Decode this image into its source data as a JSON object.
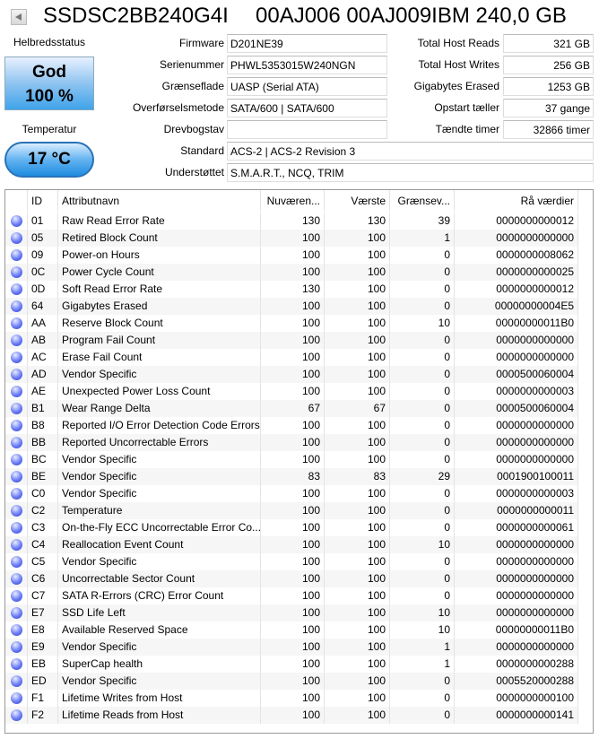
{
  "header": {
    "model": "SSDSC2BB240G4I",
    "title": "00AJ006 00AJ009IBM 240,0 GB"
  },
  "health": {
    "label": "Helbredsstatus",
    "status": "God",
    "percent": "100 %",
    "color": "#3fa3ea"
  },
  "temperature": {
    "label": "Temperatur",
    "value": "17 °C"
  },
  "info": [
    {
      "label": "Firmware",
      "value": "D201NE39"
    },
    {
      "label": "Serienummer",
      "value": "PHWL5353015W240NGN"
    },
    {
      "label": "Grænseflade",
      "value": "UASP (Serial ATA)"
    },
    {
      "label": "Overførselsmetode",
      "value": "SATA/600 | SATA/600"
    },
    {
      "label": "Drevbogstav",
      "value": ""
    },
    {
      "label": "Standard",
      "value": "ACS-2 | ACS-2 Revision 3"
    },
    {
      "label": "Understøttet",
      "value": "S.M.A.R.T., NCQ, TRIM"
    }
  ],
  "stats": [
    {
      "label": "Total Host Reads",
      "value": "321 GB"
    },
    {
      "label": "Total Host Writes",
      "value": "256 GB"
    },
    {
      "label": "Gigabytes Erased",
      "value": "1253 GB"
    },
    {
      "label": "Opstart tæller",
      "value": "37 gange"
    },
    {
      "label": "Tændte timer",
      "value": "32866 timer"
    }
  ],
  "table": {
    "columns": [
      "",
      "ID",
      "Attributnavn",
      "Nuværen...",
      "Værste",
      "Grænsev...",
      "Rå værdier"
    ],
    "rows": [
      [
        "01",
        "Raw Read Error Rate",
        "130",
        "130",
        "39",
        "0000000000012"
      ],
      [
        "05",
        "Retired Block Count",
        "100",
        "100",
        "1",
        "0000000000000"
      ],
      [
        "09",
        "Power-on Hours",
        "100",
        "100",
        "0",
        "0000000008062"
      ],
      [
        "0C",
        "Power Cycle Count",
        "100",
        "100",
        "0",
        "0000000000025"
      ],
      [
        "0D",
        "Soft Read Error Rate",
        "130",
        "100",
        "0",
        "0000000000012"
      ],
      [
        "64",
        "Gigabytes Erased",
        "100",
        "100",
        "0",
        "00000000004E5"
      ],
      [
        "AA",
        "Reserve Block Count",
        "100",
        "100",
        "10",
        "00000000011B0"
      ],
      [
        "AB",
        "Program Fail Count",
        "100",
        "100",
        "0",
        "0000000000000"
      ],
      [
        "AC",
        "Erase Fail Count",
        "100",
        "100",
        "0",
        "0000000000000"
      ],
      [
        "AD",
        "Vendor Specific",
        "100",
        "100",
        "0",
        "0000500060004"
      ],
      [
        "AE",
        "Unexpected Power Loss Count",
        "100",
        "100",
        "0",
        "0000000000003"
      ],
      [
        "B1",
        "Wear Range Delta",
        "67",
        "67",
        "0",
        "0000500060004"
      ],
      [
        "B8",
        "Reported I/O Error Detection Code Errors",
        "100",
        "100",
        "0",
        "0000000000000"
      ],
      [
        "BB",
        "Reported Uncorrectable Errors",
        "100",
        "100",
        "0",
        "0000000000000"
      ],
      [
        "BC",
        "Vendor Specific",
        "100",
        "100",
        "0",
        "0000000000000"
      ],
      [
        "BE",
        "Vendor Specific",
        "83",
        "83",
        "29",
        "0001900100011"
      ],
      [
        "C0",
        "Vendor Specific",
        "100",
        "100",
        "0",
        "0000000000003"
      ],
      [
        "C2",
        "Temperature",
        "100",
        "100",
        "0",
        "0000000000011"
      ],
      [
        "C3",
        "On-the-Fly ECC Uncorrectable Error Co...",
        "100",
        "100",
        "0",
        "0000000000061"
      ],
      [
        "C4",
        "Reallocation Event Count",
        "100",
        "100",
        "10",
        "0000000000000"
      ],
      [
        "C5",
        "Vendor Specific",
        "100",
        "100",
        "0",
        "0000000000000"
      ],
      [
        "C6",
        "Uncorrectable Sector Count",
        "100",
        "100",
        "0",
        "0000000000000"
      ],
      [
        "C7",
        "SATA R-Errors (CRC) Error Count",
        "100",
        "100",
        "0",
        "0000000000000"
      ],
      [
        "E7",
        "SSD Life Left",
        "100",
        "100",
        "10",
        "0000000000000"
      ],
      [
        "E8",
        "Available Reserved Space",
        "100",
        "100",
        "10",
        "00000000011B0"
      ],
      [
        "E9",
        "Vendor Specific",
        "100",
        "100",
        "1",
        "0000000000000"
      ],
      [
        "EB",
        "SuperCap health",
        "100",
        "100",
        "1",
        "0000000000288"
      ],
      [
        "ED",
        "Vendor Specific",
        "100",
        "100",
        "0",
        "0005520000288"
      ],
      [
        "F1",
        "Lifetime Writes from Host",
        "100",
        "100",
        "0",
        "0000000000100"
      ],
      [
        "F2",
        "Lifetime Reads from Host",
        "100",
        "100",
        "0",
        "0000000000141"
      ]
    ]
  }
}
